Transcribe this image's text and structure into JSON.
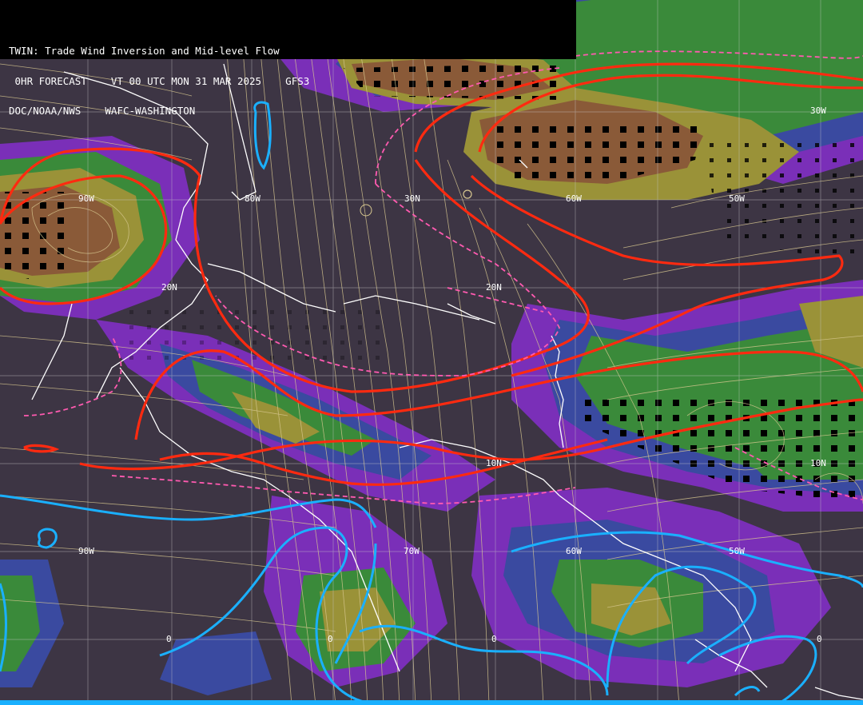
{
  "header": {
    "line1": "TWIN: Trade Wind Inversion and Mid-level Flow",
    "line2": " 0HR FORECAST    VT 00 UTC MON 31 MAR 2025    GFS3",
    "line3": "DOC/NOAA/NWS    WAFC-WASHINGTON"
  },
  "grid_labels": {
    "lat": [
      "30N",
      "20N",
      "20N",
      "10N",
      "10N",
      "0",
      "0",
      "0",
      "0"
    ],
    "lon": [
      "90W",
      "80W",
      "70W",
      "60W",
      "50W",
      "30W",
      "90W",
      "60W",
      "50W"
    ]
  },
  "colors": {
    "background": "#3d3544",
    "purple": "#7a2fb8",
    "blue": "#3a4aa0",
    "green": "#3a8a3a",
    "olive": "#9a9238",
    "brown": "#8a5a38",
    "red_contour": "#ff2a10",
    "pink_dashed": "#ff5ab0",
    "cyan_contour": "#1ab0ff",
    "coastline": "#ffffff",
    "streamline": "#d8c890",
    "grid": "#c8c8c8"
  }
}
